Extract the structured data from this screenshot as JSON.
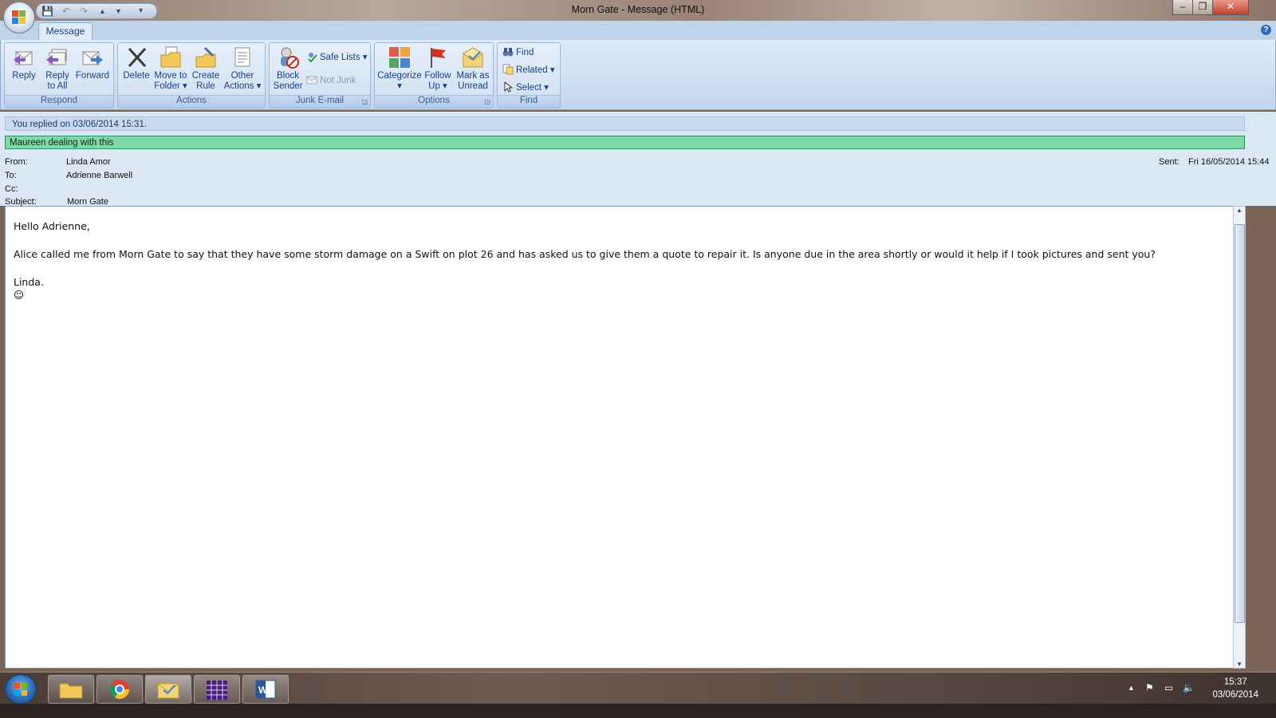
{
  "window": {
    "title": "Morn Gate - Message (HTML)",
    "minimize": "–",
    "restore": "❐",
    "close": "✕"
  },
  "quick_access": {
    "save": "💾",
    "undo": "↶",
    "redo": "↷",
    "prev": "▲",
    "next": "▼",
    "customize": "▾"
  },
  "ribbon": {
    "active_tab": "Message",
    "help": "?",
    "groups": {
      "respond": {
        "label": "Respond",
        "reply": [
          "Reply",
          ""
        ],
        "reply_all": [
          "Reply",
          "to All"
        ],
        "forward": [
          "Forward",
          ""
        ]
      },
      "actions": {
        "label": "Actions",
        "delete": [
          "Delete",
          ""
        ],
        "move": [
          "Move to",
          "Folder ▾"
        ],
        "rule": [
          "Create",
          "Rule"
        ],
        "other": [
          "Other",
          "Actions ▾"
        ]
      },
      "junk": {
        "label": "Junk E-mail",
        "block": [
          "Block",
          "Sender"
        ],
        "safe_lists": "Safe Lists ▾",
        "not_junk": "Not Junk"
      },
      "options": {
        "label": "Options",
        "categorize": [
          "Categorize",
          "▾"
        ],
        "follow_up": [
          "Follow",
          "Up ▾"
        ],
        "mark_unread": [
          "Mark as",
          "Unread"
        ]
      },
      "find": {
        "label": "Find",
        "find": "Find",
        "related": "Related ▾",
        "select": "Select ▾"
      }
    }
  },
  "info": {
    "replied": "You replied on 03/06/2014 15:31.",
    "flag": "Maureen dealing with this"
  },
  "header": {
    "from_label": "From:",
    "from": "Linda Amor",
    "to_label": "To:",
    "to": "Adrienne Barwell",
    "cc_label": "Cc:",
    "cc": "",
    "subject_label": "Subject:",
    "subject": "Morn Gate",
    "sent_label": "Sent:",
    "sent": "Fri 16/05/2014 15:44"
  },
  "body": {
    "greeting": "Hello Adrienne,",
    "paragraph": "Alice called me from Morn Gate to say that they have some storm damage on a Swift on plot 26 and has asked us to give them a quote to repair it.  Is anyone due in the area shortly or would it help if I took pictures and sent you?",
    "signature": "Linda.",
    "emoji": "☺"
  },
  "taskbar": {
    "apps": [
      "windows-explorer",
      "google-chrome",
      "microsoft-outlook",
      "calendar-app",
      "microsoft-word"
    ],
    "active_app": "microsoft-outlook",
    "time": "15:37",
    "date": "03/06/2014"
  }
}
